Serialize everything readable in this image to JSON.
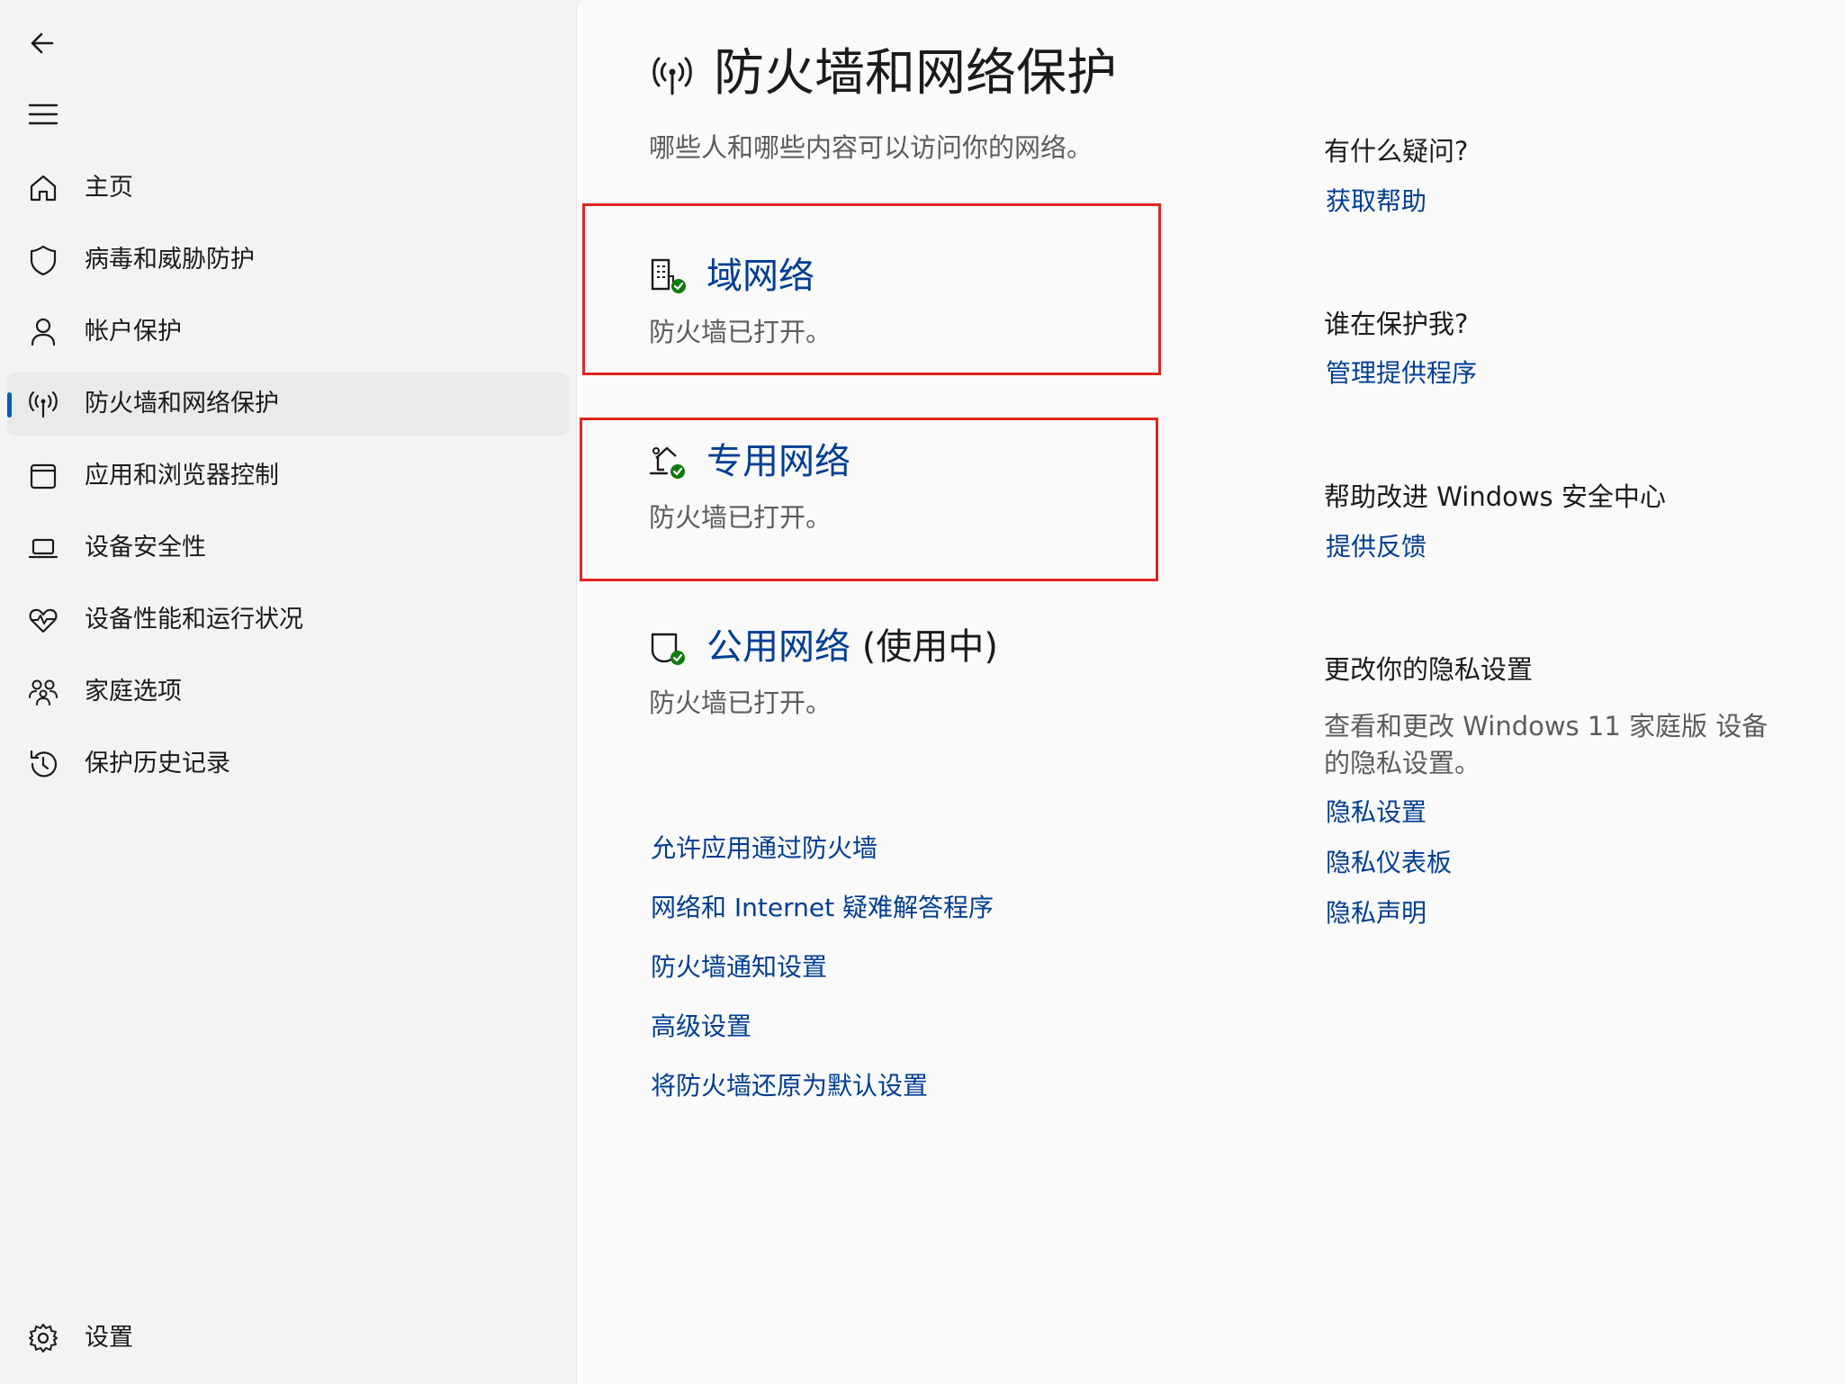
{
  "nav": {
    "items": [
      {
        "label": "主页"
      },
      {
        "label": "病毒和威胁防护"
      },
      {
        "label": "帐户保护"
      },
      {
        "label": "防火墙和网络保护"
      },
      {
        "label": "应用和浏览器控制"
      },
      {
        "label": "设备安全性"
      },
      {
        "label": "设备性能和运行状况"
      },
      {
        "label": "家庭选项"
      },
      {
        "label": "保护历史记录"
      }
    ],
    "active_index": 3,
    "settings_label": "设置"
  },
  "main": {
    "title": "防火墙和网络保护",
    "subtitle": "哪些人和哪些内容可以访问你的网络。",
    "networks": [
      {
        "name": "域网络",
        "in_use": "",
        "status": "防火墙已打开。",
        "icon": "domain-network-icon"
      },
      {
        "name": "专用网络",
        "in_use": "",
        "status": "防火墙已打开。",
        "icon": "private-network-icon"
      },
      {
        "name": "公用网络",
        "in_use": "(使用中)",
        "status": "防火墙已打开。",
        "icon": "public-network-icon"
      }
    ],
    "links": [
      "允许应用通过防火墙",
      "网络和 Internet 疑难解答程序",
      "防火墙通知设置",
      "高级设置",
      "将防火墙还原为默认设置"
    ]
  },
  "side": {
    "q_heading": "有什么疑问?",
    "q_link": "获取帮助",
    "who_heading": "谁在保护我?",
    "who_link": "管理提供程序",
    "improve_heading": "帮助改进 Windows 安全中心",
    "improve_link": "提供反馈",
    "privacy_heading": "更改你的隐私设置",
    "privacy_text": "查看和更改 Windows 11 家庭版 设备的隐私设置。",
    "privacy_links": [
      "隐私设置",
      "隐私仪表板",
      "隐私声明"
    ]
  },
  "colors": {
    "accent": "#005fb8",
    "link": "#003e92",
    "highlight_box": "#e0251f",
    "status_ok": "#0f7b0f"
  }
}
